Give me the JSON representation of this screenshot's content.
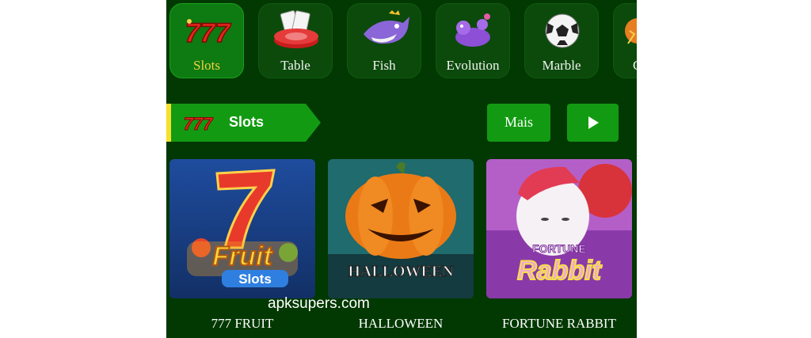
{
  "categories": [
    {
      "label": "Slots",
      "icon": "lucky-777-icon",
      "active": true
    },
    {
      "label": "Table",
      "icon": "poker-chips-cards-icon",
      "active": false
    },
    {
      "label": "Fish",
      "icon": "shark-icon",
      "active": false
    },
    {
      "label": "Evolution",
      "icon": "purple-creature-icon",
      "active": false
    },
    {
      "label": "Marble",
      "icon": "soccer-ball-icon",
      "active": false
    },
    {
      "label": "C",
      "icon": "partial-category-icon",
      "active": false
    }
  ],
  "section": {
    "title": "Slots",
    "icon": "lucky-777-icon",
    "more_label": "Mais",
    "next_icon": "play-arrow-icon"
  },
  "games": [
    {
      "name": "777 FRUIT",
      "art_line1": "Fruit",
      "art_line2": "Slots"
    },
    {
      "name": "HALLOWEEN",
      "art_line1": "HALLOWEEN"
    },
    {
      "name": "FORTUNE RABBIT",
      "art_line1": "FORTUNE",
      "art_line2": "Rabbit"
    }
  ],
  "watermark": "apksupers.com",
  "colors": {
    "background": "#023802",
    "accent": "#129b12",
    "active_label": "#f4d03f",
    "section_bar": "#f6e02b"
  }
}
